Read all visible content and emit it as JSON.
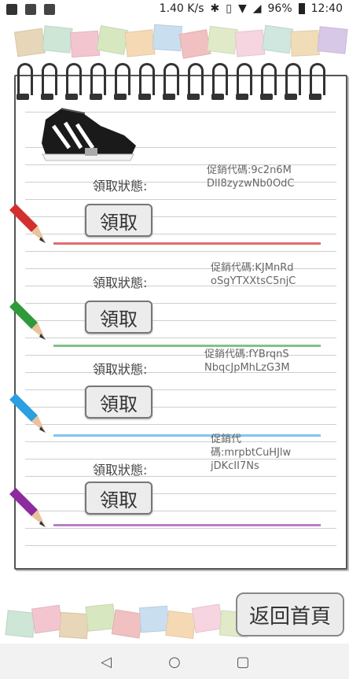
{
  "status_bar": {
    "network_speed": "1.40 K/s",
    "battery": "96%",
    "time": "12:40"
  },
  "rows": [
    {
      "status_label": "領取狀態:",
      "code": "促銷代碼:9c2n6M\nDlI8zyzwNb0OdC",
      "button": "領取",
      "color": "#d32f2f"
    },
    {
      "status_label": "領取狀態:",
      "code": "促銷代碼:KJMnRd\noSgYTXXtsC5njC",
      "button": "領取",
      "color": "#2e9a3a"
    },
    {
      "status_label": "領取狀態:",
      "code": "促銷代碼:fYBrqnS\nNbqcJpMhLzG3M",
      "button": "領取",
      "color": "#2b9fe0"
    },
    {
      "status_label": "領取狀態:",
      "code": "促銷代\n碼:mrpbtCuHJlw\njDKcII7Ns",
      "button": "領取",
      "color": "#8e2aa0"
    }
  ],
  "home_button": "返回首頁",
  "icons": {
    "statusbar_left": [
      "facebook-icon",
      "sim-icon",
      "image-icon"
    ],
    "statusbar_right": [
      "bluetooth-icon",
      "vibrate-icon",
      "wifi-icon",
      "signal-icon",
      "battery-icon"
    ],
    "navigation": [
      "back-icon",
      "home-icon",
      "recents-icon"
    ]
  }
}
